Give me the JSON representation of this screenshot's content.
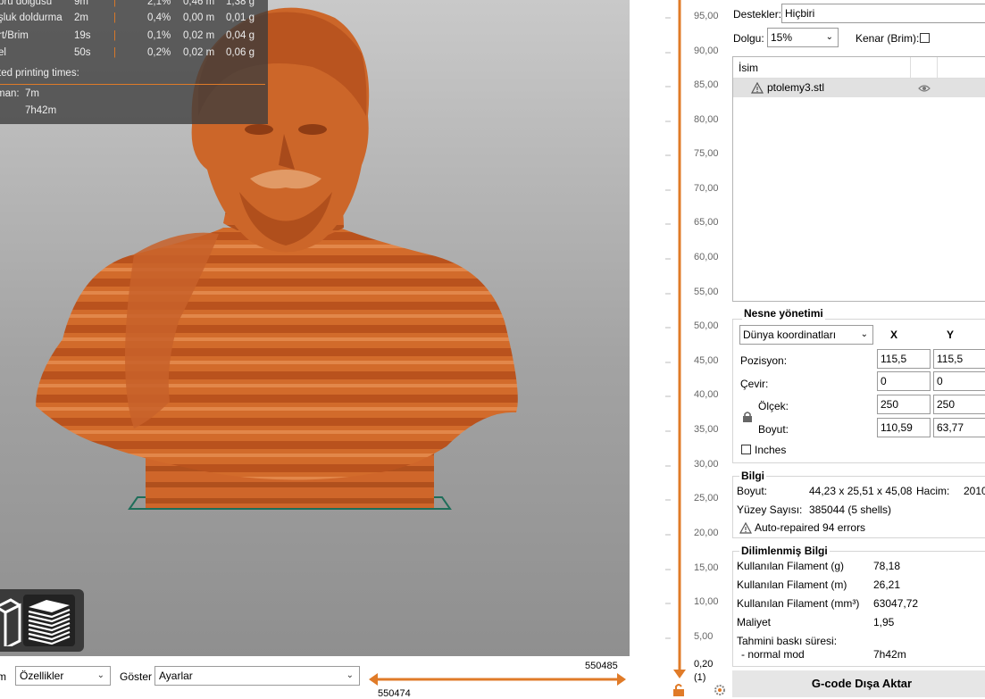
{
  "stats": {
    "rows": [
      {
        "name": "pru dolgusu",
        "time": "9m",
        "bar": "|",
        "pct": "2,1%",
        "len": "0,46 m",
        "wt": "1,38 g"
      },
      {
        "name": "şluk doldurma",
        "time": "2m",
        "bar": "|",
        "pct": "0,4%",
        "len": "0,00 m",
        "wt": "0,01 g"
      },
      {
        "name": "rt/Brim",
        "time": "19s",
        "bar": "|",
        "pct": "0,1%",
        "len": "0,02 m",
        "wt": "0,04 g"
      },
      {
        "name": "el",
        "time": "50s",
        "bar": "|",
        "pct": "0,2%",
        "len": "0,02 m",
        "wt": "0,06 g"
      }
    ],
    "estimated_title": "ted printing times:",
    "mode_label": "man:",
    "mode_value": "7m",
    "total": "7h42m"
  },
  "bottom_bar": {
    "view_type_label": "m",
    "view_type_value": "Özellikler",
    "show_label": "Göster",
    "show_value": "Ayarlar",
    "hslider_top": "550485",
    "hslider_bottom": "550474"
  },
  "vslider": {
    "ticks": [
      "95,00",
      "90,00",
      "85,00",
      "80,00",
      "75,00",
      "70,00",
      "65,00",
      "60,00",
      "55,00",
      "50,00",
      "45,00",
      "40,00",
      "35,00",
      "30,00",
      "25,00",
      "20,00",
      "15,00",
      "10,00",
      "5,00"
    ],
    "bottom_value": "0,20",
    "bottom_index": "(1)"
  },
  "sidebar": {
    "supports_label": "Destekler:",
    "supports_value": "Hiçbiri",
    "infill_label": "Dolgu:",
    "infill_value": "15%",
    "brim_label": "Kenar (Brim):",
    "list_header_name": "İsim",
    "object_name": "ptolemy3.stl",
    "object_management_title": "Nesne yönetimi",
    "coords_value": "Dünya koordinatları",
    "axis_x": "X",
    "axis_y": "Y",
    "position_label": "Pozisyon:",
    "position_x": "115,5",
    "position_y": "115,5",
    "rotate_label": "Çevir:",
    "rotate_x": "0",
    "rotate_y": "0",
    "scale_label": "Ölçek:",
    "scale_x": "250",
    "scale_y": "250",
    "size_label": "Boyut:",
    "size_x": "110,59",
    "size_y": "63,77",
    "inches_label": "Inches",
    "info_title": "Bilgi",
    "info_size_label": "Boyut:",
    "info_size_value": "44,23 x 25,51 x 45,08",
    "info_volume_label": "Hacim:",
    "info_volume_value": "2010",
    "info_facets_label": "Yüzey Sayısı:",
    "info_facets_value": "385044 (5 shells)",
    "info_repaired": "Auto-repaired 94 errors",
    "sliced_title": "Dilimlenmiş Bilgi",
    "sliced": [
      {
        "label": "Kullanılan Filament (g)",
        "value": "78,18"
      },
      {
        "label": "Kullanılan Filament (m)",
        "value": "26,21"
      },
      {
        "label": "Kullanılan Filament (mm³)",
        "value": "63047,72"
      },
      {
        "label": "Maliyet",
        "value": "1,95"
      }
    ],
    "est_time_label": "Tahmini baskı süresi:",
    "normal_mode_label": "- normal mod",
    "normal_mode_value": "7h42m",
    "export_label": "G-code Dışa Aktar"
  },
  "colors": {
    "accent": "#e07b28",
    "model": "#d0692a",
    "model_dark": "#a9481a",
    "bed_outline": "#1f6e5a"
  }
}
